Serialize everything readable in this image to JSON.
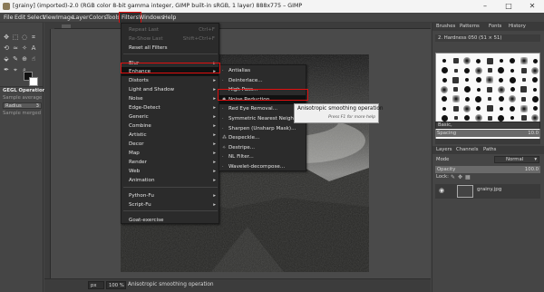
{
  "window": {
    "title": "[grainy] (imported)-2.0 (RGB color 8-bit gamma integer, GIMP built-in sRGB, 1 layer) 888x775 – GIMP",
    "controls": [
      "–",
      "□",
      "✕"
    ]
  },
  "menubar": [
    "File",
    "Edit",
    "Select",
    "View",
    "Image",
    "Layer",
    "Colors",
    "Tools",
    "Filters",
    "Windows",
    "Help"
  ],
  "filters_menu": {
    "items": [
      {
        "label": "Repeat Last",
        "accel": "Ctrl+F",
        "dim": true
      },
      {
        "label": "Re-Show Last",
        "accel": "Shift+Ctrl+F",
        "dim": true
      },
      {
        "label": "Reset all Filters"
      },
      {
        "label": "Blur",
        "sub": true
      },
      {
        "label": "Enhance",
        "sub": true,
        "active": true
      },
      {
        "label": "Distorts",
        "sub": true
      },
      {
        "label": "Light and Shadow",
        "sub": true
      },
      {
        "label": "Noise",
        "sub": true
      },
      {
        "label": "Edge-Detect",
        "sub": true
      },
      {
        "label": "Generic",
        "sub": true
      },
      {
        "label": "Combine",
        "sub": true
      },
      {
        "label": "Artistic",
        "sub": true
      },
      {
        "label": "Decor",
        "sub": true
      },
      {
        "label": "Map",
        "sub": true
      },
      {
        "label": "Render",
        "sub": true
      },
      {
        "label": "Web",
        "sub": true
      },
      {
        "label": "Animation",
        "sub": true
      },
      {
        "label": "Python-Fu",
        "sub": true
      },
      {
        "label": "Script-Fu",
        "sub": true
      },
      {
        "label": "Goat-exercise"
      }
    ]
  },
  "enhance_menu": {
    "items": [
      {
        "label": "Antialias"
      },
      {
        "label": "Deinterlace..."
      },
      {
        "label": "High Pass..."
      },
      {
        "label": "Noise Reduction...",
        "active": true
      },
      {
        "label": "Red Eye Removal..."
      },
      {
        "label": "Symmetric Nearest Neighbor..."
      },
      {
        "label": "Sharpen (Unsharp Mask)..."
      },
      {
        "label": "Despeckle..."
      },
      {
        "label": "Destripe..."
      },
      {
        "label": "NL Filter..."
      },
      {
        "label": "Wavelet-decompose..."
      }
    ]
  },
  "tooltip": {
    "text": "Anisotropic smoothing operation",
    "hint": "Press F1 for more help"
  },
  "tool_options": {
    "title": "GEGL Operation",
    "sample_average": "Sample average",
    "radius_label": "Radius",
    "radius_value": "3",
    "sample_merged": "Sample merged"
  },
  "dock": {
    "tabs": [
      "Brushes",
      "Patterns",
      "Fonts",
      "History"
    ],
    "brush_name": "2. Hardness 050 (51 × 51)",
    "preset": "Basic,",
    "spacing_label": "Spacing",
    "spacing_value": "10.0",
    "layer_tabs": [
      "Layers",
      "Channels",
      "Paths"
    ],
    "mode_label": "Mode",
    "mode_value": "Normal",
    "opacity_label": "Opacity",
    "opacity_value": "100.0",
    "lock_label": "Lock:",
    "layer_name": "grainy.jpg"
  },
  "statusbar": {
    "unit": "px",
    "zoom": "100 %",
    "message": "Anisotropic smoothing operation"
  },
  "colors": {
    "highlight": "#e01010",
    "menu_bg": "#2b2b2b",
    "panel": "#454545"
  }
}
